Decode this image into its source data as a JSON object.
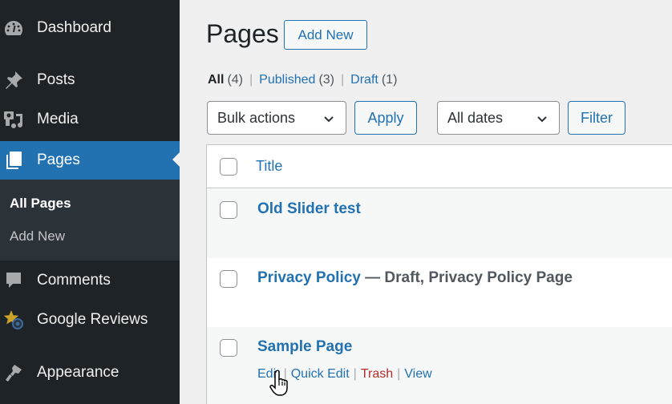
{
  "sidebar": {
    "items": [
      {
        "label": "Dashboard",
        "icon": "dashboard-icon"
      },
      {
        "label": "Posts",
        "icon": "pin-icon"
      },
      {
        "label": "Media",
        "icon": "media-icon"
      },
      {
        "label": "Pages",
        "icon": "pages-icon",
        "active": true
      },
      {
        "label": "Comments",
        "icon": "comment-icon"
      },
      {
        "label": "Google Reviews",
        "icon": "star-icon"
      },
      {
        "label": "Appearance",
        "icon": "paintbrush-icon"
      }
    ],
    "submenu": [
      {
        "label": "All Pages",
        "current": true
      },
      {
        "label": "Add New"
      }
    ]
  },
  "header": {
    "title": "Pages",
    "add_new_label": "Add New"
  },
  "views": {
    "all_label": "All",
    "all_count": "(4)",
    "published_label": "Published",
    "published_count": "(3)",
    "draft_label": "Draft",
    "draft_count": "(1)",
    "separator": "|"
  },
  "toolbar": {
    "bulk_actions": "Bulk actions",
    "apply_label": "Apply",
    "dates": "All dates",
    "filter_label": "Filter"
  },
  "table": {
    "columns": [
      "Title"
    ],
    "rows": [
      {
        "title": "Old Slider test",
        "state": ""
      },
      {
        "title": "Privacy Policy",
        "state": " — Draft, Privacy Policy Page"
      },
      {
        "title": "Sample Page",
        "state": "",
        "actions": [
          "Edit",
          "Quick Edit",
          "Trash",
          "View"
        ]
      }
    ]
  },
  "colors": {
    "sidebar_bg": "#1d2327",
    "accent": "#2271b1",
    "trash": "#b32d2e",
    "page_bg": "#f0f0f1"
  }
}
